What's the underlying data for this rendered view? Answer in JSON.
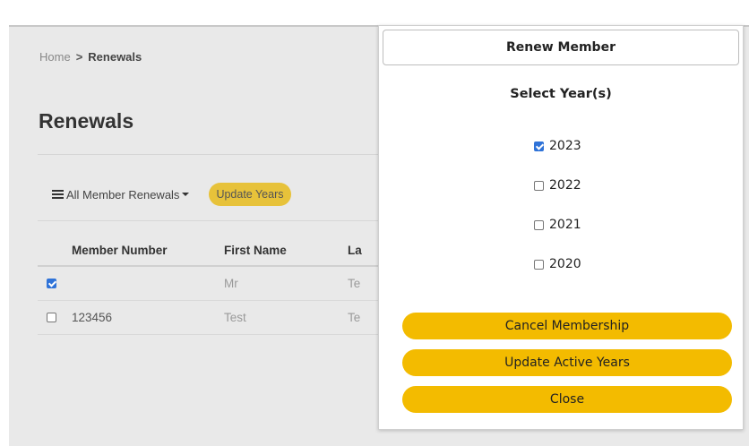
{
  "breadcrumb": {
    "home": "Home",
    "separator": ">",
    "current": "Renewals"
  },
  "page": {
    "title": "Renewals"
  },
  "toolbar": {
    "dropdown_label": "All Member Renewals",
    "update_years_label": "Update Years"
  },
  "table": {
    "headers": [
      "Member Number",
      "First Name",
      "La"
    ],
    "rows": [
      {
        "checked": true,
        "member_number": "",
        "first_name": "Mr",
        "last_name": "Te"
      },
      {
        "checked": false,
        "member_number": "123456",
        "first_name": "Test",
        "last_name": "Te"
      }
    ]
  },
  "modal": {
    "title": "Renew Member",
    "select_title": "Select Year(s)",
    "years": [
      {
        "label": "2023",
        "checked": true
      },
      {
        "label": "2022",
        "checked": false
      },
      {
        "label": "2021",
        "checked": false
      },
      {
        "label": "2020",
        "checked": false
      }
    ],
    "buttons": {
      "cancel": "Cancel Membership",
      "update": "Update  Active Years",
      "close": "Close"
    }
  },
  "colors": {
    "accent": "#f3bb00",
    "accent_small": "#e7c23a",
    "checkbox": "#2f73d8"
  }
}
